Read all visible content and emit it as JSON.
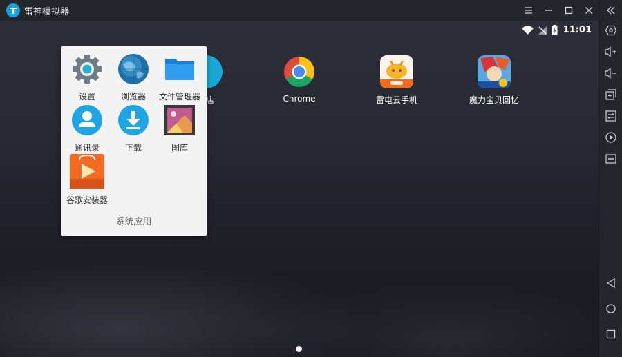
{
  "window": {
    "title": "雷神模拟器"
  },
  "status_bar": {
    "time": "11:01"
  },
  "desktop": {
    "apps": [
      {
        "label": "商店"
      },
      {
        "label": "Chrome"
      },
      {
        "label": "雷电云手机"
      },
      {
        "label": "魔力宝贝回忆"
      }
    ]
  },
  "folder": {
    "name": "系统应用",
    "apps": [
      {
        "label": "设置"
      },
      {
        "label": "浏览器"
      },
      {
        "label": "文件管理器"
      },
      {
        "label": "通讯录"
      },
      {
        "label": "下载"
      },
      {
        "label": "图库"
      },
      {
        "label": "谷歌安装器"
      }
    ]
  },
  "icons": {
    "titlebar": [
      "app-logo-icon",
      "menu-icon",
      "minimize-icon",
      "maximize-icon",
      "close-icon"
    ],
    "toolbar": [
      "collapse-icon",
      "settings-hex-icon",
      "volume-up-icon",
      "volume-down-icon",
      "screenshot-icon",
      "sync-icon",
      "record-icon",
      "more-icon",
      "back-icon",
      "home-icon",
      "recents-icon"
    ]
  },
  "colors": {
    "chrome_bg": "#25262c",
    "folder_bg": "#f3f3f3",
    "accent_blue": "#1a9fe0"
  }
}
